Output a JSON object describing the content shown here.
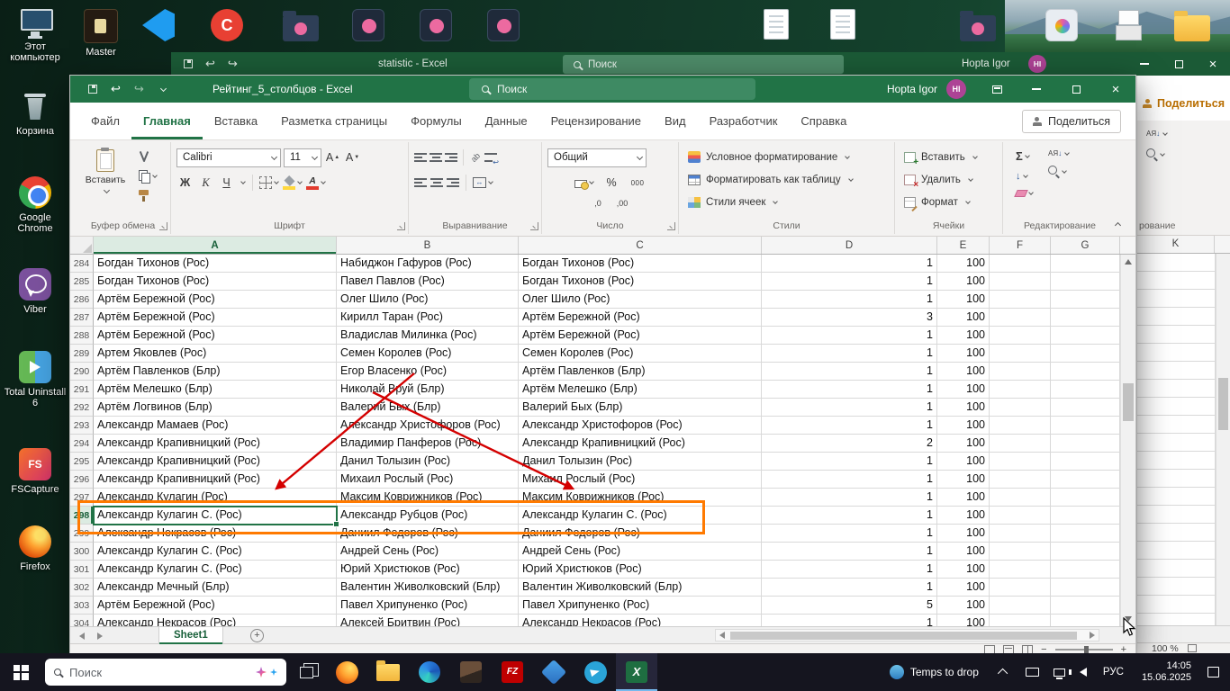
{
  "desktop": {
    "left_icons": [
      {
        "name": "this-pc",
        "label": "Этот компьютер"
      },
      {
        "name": "recycle-bin",
        "label": "Корзина"
      },
      {
        "name": "google-chrome",
        "label": "Google Chrome"
      },
      {
        "name": "viber",
        "label": "Viber"
      },
      {
        "name": "total-uninstall",
        "label": "Total Uninstall 6"
      },
      {
        "name": "fscapture",
        "label": "FSCapture"
      },
      {
        "name": "firefox",
        "label": "Firefox"
      }
    ],
    "top_icons": [
      {
        "name": "master-app",
        "label": "Master"
      },
      {
        "name": "vscode",
        "label": ""
      },
      {
        "name": "ccleaner",
        "label": ""
      },
      {
        "name": "postgres-folder-1",
        "label": ""
      },
      {
        "name": "postgres-app-1",
        "label": ""
      },
      {
        "name": "postgres-app-2",
        "label": ""
      },
      {
        "name": "postgres-app-3",
        "label": ""
      },
      {
        "name": "document-1",
        "label": ""
      },
      {
        "name": "document-2",
        "label": ""
      },
      {
        "name": "postgres-folder-2",
        "label": ""
      },
      {
        "name": "app-tile",
        "label": ""
      },
      {
        "name": "archive-boxes",
        "label": ""
      },
      {
        "name": "yellow-folder",
        "label": ""
      }
    ]
  },
  "bg_window": {
    "title": "statistic - Excel",
    "search_placeholder": "Поиск",
    "user_name": "Hopta Igor",
    "user_initials": "HI",
    "share_label": "Поделиться",
    "column_header": "K",
    "group_label_partial": "рование",
    "zoom_label": "100 %"
  },
  "excel_window": {
    "accent": "#217346",
    "titlebar": {
      "title": "Рейтинг_5_столбцов - Excel",
      "search_placeholder": "Поиск",
      "user_name": "Hopta Igor",
      "user_initials": "HI"
    },
    "tabs": [
      "Файл",
      "Главная",
      "Вставка",
      "Разметка страницы",
      "Формулы",
      "Данные",
      "Рецензирование",
      "Вид",
      "Разработчик",
      "Справка"
    ],
    "active_tab": "Главная",
    "share_label": "Поделиться",
    "ribbon": {
      "paste_label": "Вставить",
      "font_name": "Calibri",
      "font_size": "11",
      "bold": "Ж",
      "italic": "К",
      "underline": "Ч",
      "grow_font": "А",
      "shrink_font": "А",
      "number_format": "Общий",
      "percent": "%",
      "thousands": "000",
      "decimal_buttons": [
        ",0",
        ",00"
      ],
      "styles_buttons": [
        "Условное форматирование",
        "Форматировать как таблицу",
        "Стили ячеек"
      ],
      "cells_buttons": [
        "Вставить",
        "Удалить",
        "Формат"
      ],
      "autosum": "Σ",
      "group_labels": [
        "Буфер обмена",
        "Шрифт",
        "Выравнивание",
        "Число",
        "Стили",
        "Ячейки",
        "Редактирование"
      ]
    },
    "grid": {
      "column_headers": [
        "A",
        "B",
        "C",
        "D",
        "E",
        "F",
        "G"
      ],
      "rows": [
        [
          284,
          "Богдан Тихонов (Рос)",
          "Набиджон Гафуров (Рос)",
          "Богдан Тихонов (Рос)",
          "1",
          "100"
        ],
        [
          285,
          "Богдан Тихонов (Рос)",
          "Павел Павлов (Рос)",
          "Богдан Тихонов (Рос)",
          "1",
          "100"
        ],
        [
          286,
          "Артём Бережной (Рос)",
          "Олег Шило (Рос)",
          "Олег Шило (Рос)",
          "1",
          "100"
        ],
        [
          287,
          "Артём Бережной (Рос)",
          "Кирилл Таран (Рос)",
          "Артём Бережной (Рос)",
          "3",
          "100"
        ],
        [
          288,
          "Артём Бережной (Рос)",
          "Владислав Милинка (Рос)",
          "Артём Бережной (Рос)",
          "1",
          "100"
        ],
        [
          289,
          "Артем Яковлев (Рос)",
          "Семен Королев (Рос)",
          "Семен Королев (Рос)",
          "1",
          "100"
        ],
        [
          290,
          "Артём Павленков (Блр)",
          "Егор Власенко (Рос)",
          "Артём Павленков (Блр)",
          "1",
          "100"
        ],
        [
          291,
          "Артём Мелешко (Блр)",
          "Николай Вруй (Блр)",
          "Артём Мелешко (Блр)",
          "1",
          "100"
        ],
        [
          292,
          "Артём Логвинов (Блр)",
          "Валерий Бых (Блр)",
          "Валерий Бых (Блр)",
          "1",
          "100"
        ],
        [
          293,
          "Александр Мамаев (Рос)",
          "Александр Христофоров (Рос)",
          "Александр Христофоров (Рос)",
          "1",
          "100"
        ],
        [
          294,
          "Александр Крапивницкий (Рос)",
          "Владимир Панферов (Рос)",
          "Александр Крапивницкий (Рос)",
          "2",
          "100"
        ],
        [
          295,
          "Александр Крапивницкий (Рос)",
          "Данил Толызин (Рос)",
          "Данил Толызин (Рос)",
          "1",
          "100"
        ],
        [
          296,
          "Александр Крапивницкий (Рос)",
          "Михаил Рослый (Рос)",
          "Михаил Рослый (Рос)",
          "1",
          "100"
        ],
        [
          297,
          "Александр Кулагин (Рос)",
          "Максим Коврижников (Рос)",
          "Максим Коврижников (Рос)",
          "1",
          "100"
        ],
        [
          298,
          "Александр Кулагин С. (Рос)",
          "Александр Рубцов (Рос)",
          "Александр Кулагин С. (Рос)",
          "1",
          "100"
        ],
        [
          299,
          "Александр Некрасов (Рос)",
          "Даниил Федоров (Рос)",
          "Даниил Федоров (Рос)",
          "1",
          "100"
        ],
        [
          300,
          "Александр Кулагин С. (Рос)",
          "Андрей Сень (Рос)",
          "Андрей Сень (Рос)",
          "1",
          "100"
        ],
        [
          301,
          "Александр Кулагин С. (Рос)",
          "Юрий Христюков (Рос)",
          "Юрий Христюков (Рос)",
          "1",
          "100"
        ],
        [
          302,
          "Александр Мечный (Блр)",
          "Валентин Живолковский (Блр)",
          "Валентин Живолковский (Блр)",
          "1",
          "100"
        ],
        [
          303,
          "Артём Бережной (Рос)",
          "Павел Хрипуненко (Рос)",
          "Павел Хрипуненко (Рос)",
          "5",
          "100"
        ],
        [
          304,
          "Александр Некрасов (Рос)",
          "Алексей Бритвин (Рос)",
          "Александр Некрасов (Рос)",
          "1",
          "100"
        ]
      ],
      "selected_row": 298,
      "selected_col": "A"
    },
    "sheet_tab": "Sheet1",
    "new_sheet_label": "+",
    "status": {
      "zoom_out": "−",
      "zoom_in": "+"
    }
  },
  "annotations": {
    "highlight_color": "#ff7a00",
    "arrow_color": "#d40000"
  },
  "taskbar": {
    "search_placeholder": "Поиск",
    "apps": [
      "firefox",
      "explorer-folder",
      "edge",
      "photos",
      "filezilla",
      "app-cube",
      "telegram",
      "excel"
    ],
    "active_app": "excel",
    "tray_app": "Temps to drop",
    "language": "РУС",
    "time": "14:05",
    "date": "15.06.2025"
  }
}
